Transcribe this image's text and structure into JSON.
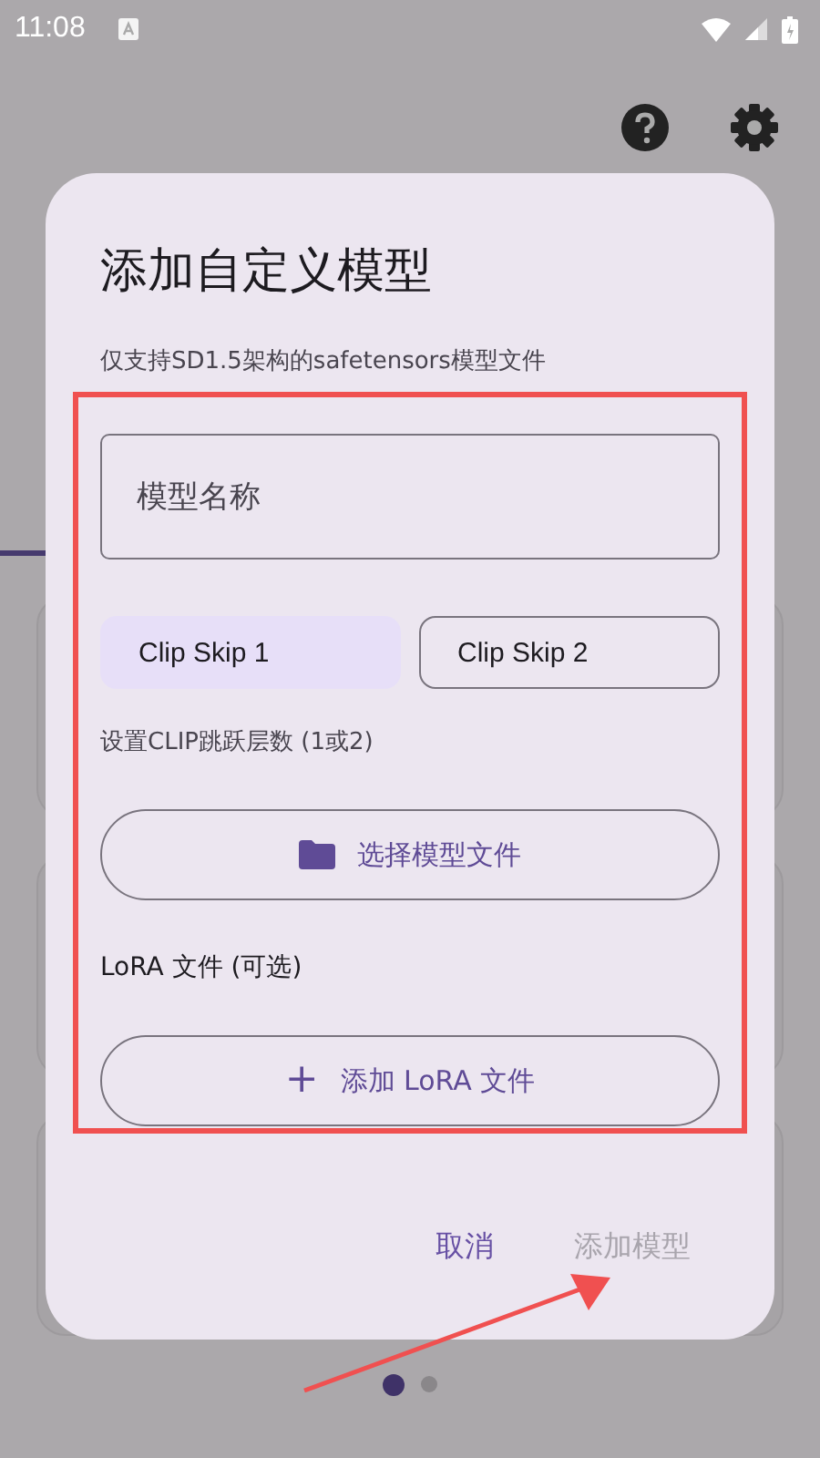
{
  "status_bar": {
    "time": "11:08"
  },
  "dialog": {
    "title": "添加自定义模型",
    "subtitle": "仅支持SD1.5架构的safetensors模型文件",
    "name_field": {
      "placeholder": "模型名称"
    },
    "clip_options": [
      {
        "label": "Clip Skip 1",
        "selected": true
      },
      {
        "label": "Clip Skip 2",
        "selected": false
      }
    ],
    "clip_hint": "设置CLIP跳跃层数 (1或2)",
    "choose_file": {
      "label": "选择模型文件"
    },
    "lora_label": "LoRA 文件 (可选)",
    "add_lora": {
      "icon": "+",
      "label": "添加 LoRA 文件"
    },
    "actions": [
      {
        "label": "取消",
        "disabled": false
      },
      {
        "label": "添加模型",
        "disabled": true
      }
    ]
  },
  "pager": [
    {
      "selected": true
    },
    {
      "selected": false
    }
  ]
}
